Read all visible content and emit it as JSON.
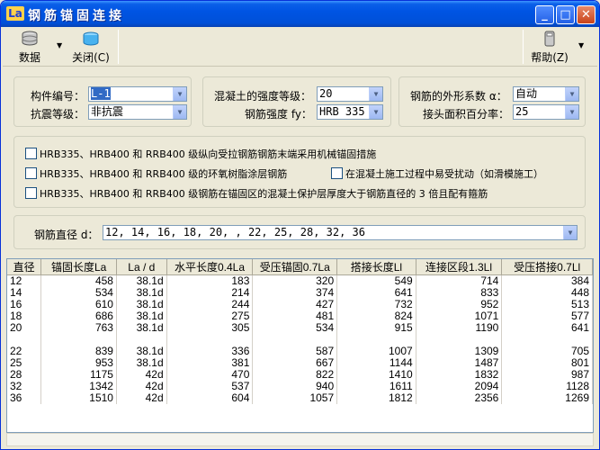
{
  "window": {
    "title": "钢筋锚固连接",
    "app_icon": "La"
  },
  "toolbar": {
    "data_label": "数据",
    "close_label": "关闭(C)",
    "help_label": "帮助(Z)"
  },
  "params": {
    "member_no_label": "构件编号：",
    "member_no_value": "L-1",
    "seismic_label": "抗震等级：",
    "seismic_value": "非抗震",
    "concrete_label": "混凝土的强度等级：",
    "concrete_value": "20",
    "rebar_strength_label": "钢筋强度 fy：",
    "rebar_strength_value": "HRB 335",
    "shape_coef_label": "钢筋的外形系数 α：",
    "shape_coef_value": "自动",
    "lap_area_label": "接头面积百分率：",
    "lap_area_value": "25"
  },
  "options": {
    "opt1": "HRB335、HRB400 和 RRB400 级纵向受拉钢筋钢筋末端采用机械锚固措施",
    "opt2": "HRB335、HRB400 和 RRB400 级的环氧树脂涂层钢筋",
    "opt3": "在混凝土施工过程中易受扰动（如滑模施工）",
    "opt4": "HRB335、HRB400 和 RRB400 级钢筋在锚固区的混凝土保护层厚度大于钢筋直径的 3 倍且配有箍筋"
  },
  "diameter": {
    "label": "钢筋直径 d：",
    "value": "12, 14, 16, 18, 20, , 22, 25, 28, 32, 36"
  },
  "table": {
    "headers": [
      "直径",
      "锚固长度La",
      "La / d",
      "水平长度0.4La",
      "受压锚固0.7La",
      "搭接长度Ll",
      "连接区段1.3Ll",
      "受压搭接0.7Ll"
    ],
    "rows": [
      [
        "12",
        "458",
        "38.1d",
        "183",
        "320",
        "549",
        "714",
        "384"
      ],
      [
        "14",
        "534",
        "38.1d",
        "214",
        "374",
        "641",
        "833",
        "448"
      ],
      [
        "16",
        "610",
        "38.1d",
        "244",
        "427",
        "732",
        "952",
        "513"
      ],
      [
        "18",
        "686",
        "38.1d",
        "275",
        "481",
        "824",
        "1071",
        "577"
      ],
      [
        "20",
        "763",
        "38.1d",
        "305",
        "534",
        "915",
        "1190",
        "641"
      ],
      [
        "",
        "",
        "",
        "",
        "",
        "",
        "",
        ""
      ],
      [
        "22",
        "839",
        "38.1d",
        "336",
        "587",
        "1007",
        "1309",
        "705"
      ],
      [
        "25",
        "953",
        "38.1d",
        "381",
        "667",
        "1144",
        "1487",
        "801"
      ],
      [
        "28",
        "1175",
        "42d",
        "470",
        "822",
        "1410",
        "1832",
        "987"
      ],
      [
        "32",
        "1342",
        "42d",
        "537",
        "940",
        "1611",
        "2094",
        "1128"
      ],
      [
        "36",
        "1510",
        "42d",
        "604",
        "1057",
        "1812",
        "2356",
        "1269"
      ]
    ]
  }
}
